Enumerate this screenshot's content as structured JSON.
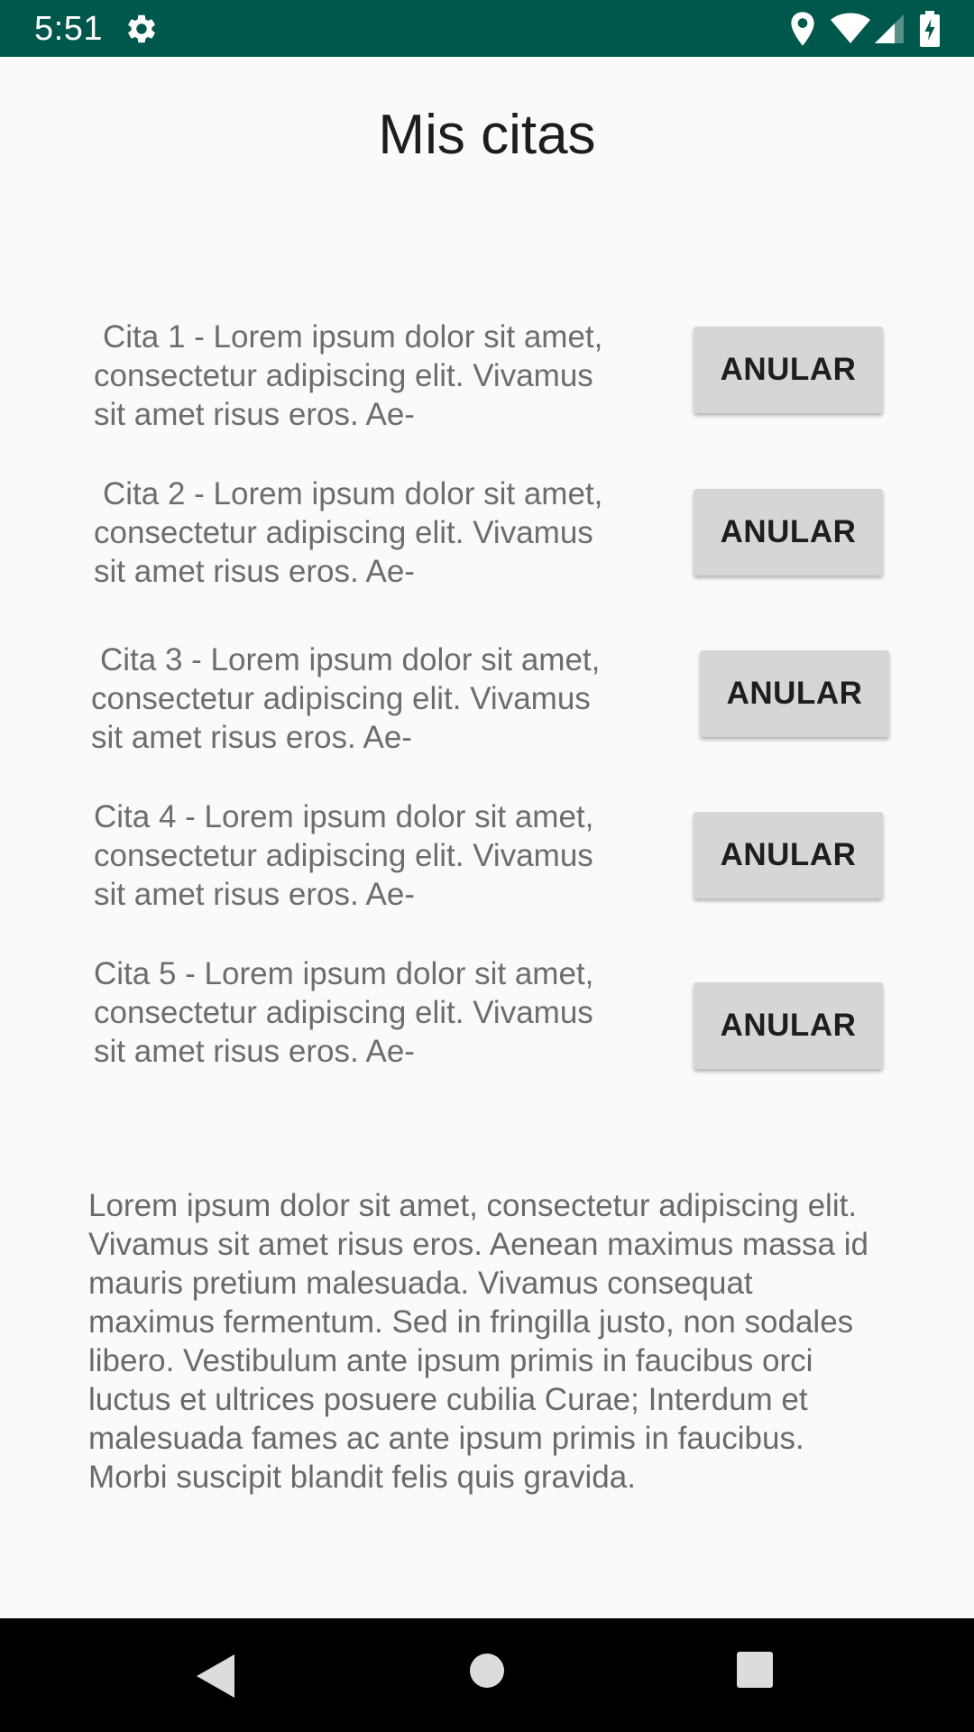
{
  "status_bar": {
    "time": "5:51",
    "color": "#00574b",
    "icons": [
      "gear-icon",
      "location-icon",
      "wifi-icon",
      "signal-icon",
      "battery-icon"
    ]
  },
  "page": {
    "title": "Mis citas"
  },
  "citas": [
    {
      "text": "Cita 1 - Lorem ipsum dolor sit amet, consectetur adipiscing elit. Vivamus sit amet risus eros. Ae-",
      "button_label": "ANULAR"
    },
    {
      "text": "Cita 2 - Lorem ipsum dolor sit amet, consectetur adipiscing elit. Vivamus sit amet risus eros. Ae-",
      "button_label": "ANULAR"
    },
    {
      "text": "Cita 3 - Lorem ipsum dolor sit amet, consectetur adipiscing elit. Vivamus sit amet risus eros. Ae-",
      "button_label": "ANULAR"
    },
    {
      "text": "Cita 4 - Lorem ipsum dolor sit amet, consectetur adipiscing elit. Vivamus sit amet risus eros. Ae-",
      "button_label": "ANULAR"
    },
    {
      "text": "Cita 5 - Lorem ipsum dolor sit amet, consectetur adipiscing elit. Vivamus sit amet risus eros. Ae-",
      "button_label": "ANULAR"
    }
  ],
  "paragraph": "Lorem ipsum dolor sit amet, consectetur adipiscing elit. Vivamus sit amet risus eros. Aenean maximus massa id mauris pretium malesuada. Vivamus consequat maximus fermentum. Sed in fringilla justo, non sodales libero. Vestibulum ante ipsum primis in faucibus orci luctus et ultrices posuere cubilia Curae; Interdum et malesuada fames ac ante ipsum primis in faucibus. Morbi suscipit blandit felis quis gravida.",
  "nav_bar": {
    "icons": [
      "back-icon",
      "home-icon",
      "recents-icon"
    ]
  }
}
